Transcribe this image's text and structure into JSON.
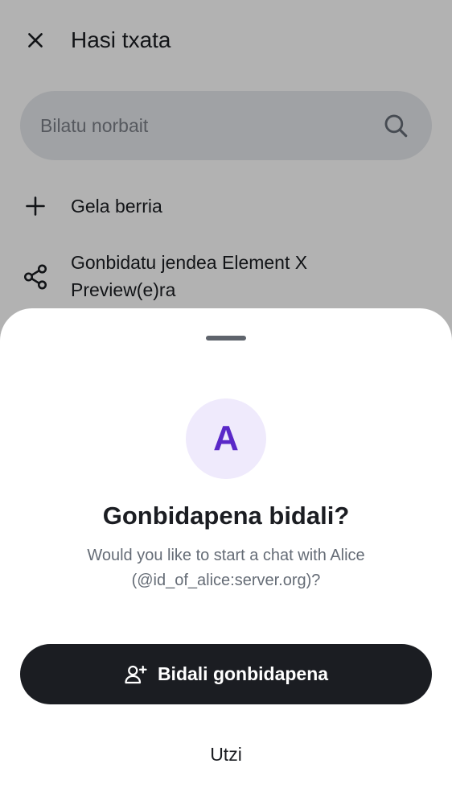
{
  "colors": {
    "accent": "#5a28c8",
    "avatar_bg": "#efeafc",
    "primary_button_bg": "#1b1d22",
    "scrim": "rgba(0,0,0,0.30)"
  },
  "header": {
    "close_icon": "close-icon",
    "title": "Hasi txata"
  },
  "search": {
    "placeholder": "Bilatu norbait",
    "icon": "search-icon"
  },
  "actions": [
    {
      "icon": "plus-icon",
      "label": "Gela berria"
    },
    {
      "icon": "share-icon",
      "label": "Gonbidatu jendea Element X Preview(e)ra"
    }
  ],
  "dialog": {
    "avatar_letter": "A",
    "title": "Gonbidapena bidali?",
    "message": "Would you like to start a chat with Alice (@id_of_alice:server.org)?",
    "primary_button": {
      "icon": "add-user-icon",
      "label": "Bidali gonbidapena"
    },
    "secondary_button": {
      "label": "Utzi"
    }
  }
}
